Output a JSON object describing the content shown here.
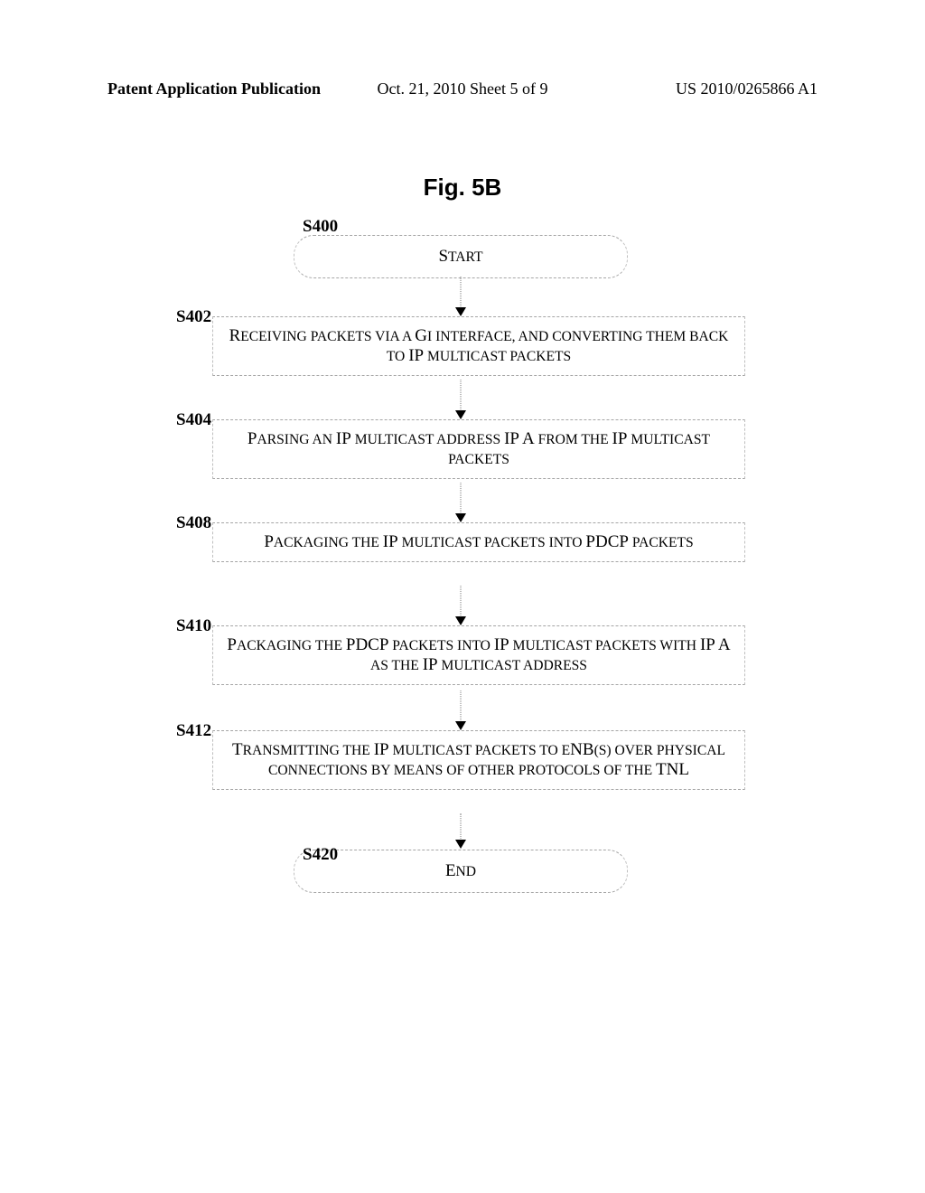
{
  "header": {
    "left": "Patent Application Publication",
    "center": "Oct. 21, 2010  Sheet 5 of 9",
    "right": "US 2010/0265866 A1"
  },
  "figure": {
    "title": "Fig. 5B"
  },
  "steps": {
    "s400": {
      "label": "S400",
      "text": "Start"
    },
    "s402": {
      "label": "S402",
      "text": "Receiving packets via a Gi interface, and converting them back to IP multicast packets"
    },
    "s404": {
      "label": "S404",
      "text": "Parsing an IP multicast address IP A from the IP multicast packets"
    },
    "s408": {
      "label": "S408",
      "text": "Packaging the IP multicast packets into PDCP packets"
    },
    "s410": {
      "label": "S410",
      "text": "Packaging the PDCP packets into IP multicast packets with IP A as the IP multicast address"
    },
    "s412": {
      "label": "S412",
      "text": "Transmitting the IP multicast packets to eNB(s) over physical connections by means of other protocols of the TNL"
    },
    "s420": {
      "label": "S420",
      "text": "End"
    }
  },
  "chart_data": {
    "type": "flowchart",
    "nodes": [
      {
        "id": "S400",
        "type": "terminator",
        "text": "Start"
      },
      {
        "id": "S402",
        "type": "process",
        "text": "Receiving packets via a Gi interface, and converting them back to IP multicast packets"
      },
      {
        "id": "S404",
        "type": "process",
        "text": "Parsing an IP multicast address IP A from the IP multicast packets"
      },
      {
        "id": "S408",
        "type": "process",
        "text": "Packaging the IP multicast packets into PDCP packets"
      },
      {
        "id": "S410",
        "type": "process",
        "text": "Packaging the PDCP packets into IP multicast packets with IP A as the IP multicast address"
      },
      {
        "id": "S412",
        "type": "process",
        "text": "Transmitting the IP multicast packets to eNB(s) over physical connections by means of other protocols of the TNL"
      },
      {
        "id": "S420",
        "type": "terminator",
        "text": "End"
      }
    ],
    "edges": [
      {
        "from": "S400",
        "to": "S402"
      },
      {
        "from": "S402",
        "to": "S404"
      },
      {
        "from": "S404",
        "to": "S408"
      },
      {
        "from": "S408",
        "to": "S410"
      },
      {
        "from": "S410",
        "to": "S412"
      },
      {
        "from": "S412",
        "to": "S420"
      }
    ]
  }
}
